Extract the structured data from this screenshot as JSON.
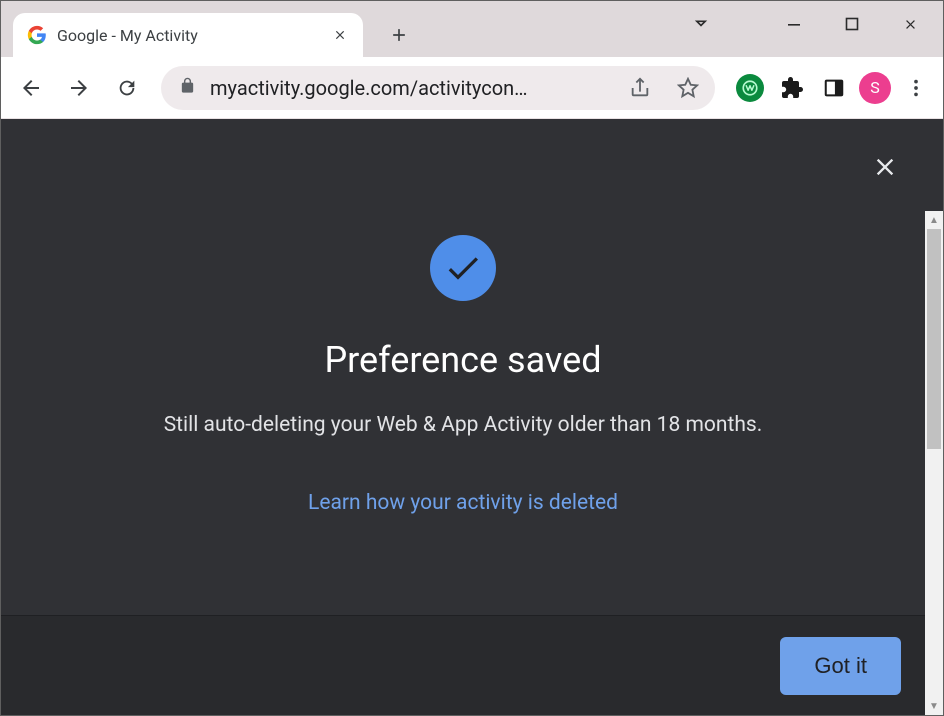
{
  "browser": {
    "tab_title": "Google - My Activity",
    "url_display": "myactivity.google.com/activitycon…",
    "avatar_initial": "S",
    "green_ext_letter": "W"
  },
  "dialog": {
    "title": "Preference saved",
    "subtitle": "Still auto-deleting your Web & App Activity older than 18 months.",
    "learn_link": "Learn how your activity is deleted",
    "confirm_button": "Got it"
  }
}
